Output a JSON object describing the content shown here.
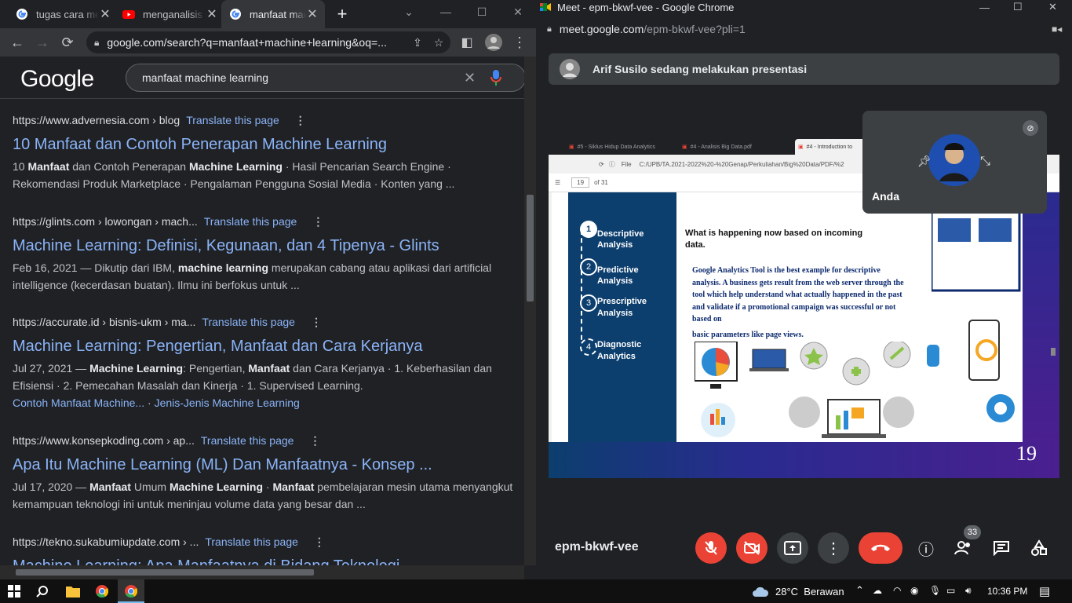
{
  "left_browser": {
    "tabs": [
      {
        "title": "tugas cara membuat",
        "favicon": "google-g-icon"
      },
      {
        "title": "menganalisis data",
        "favicon": "youtube-icon"
      },
      {
        "title": "manfaat machine learning",
        "favicon": "google-g-icon"
      }
    ],
    "new_tab": "+",
    "url": "google.com/search?q=manfaat+machine+learning&oq=...",
    "logo": "Google",
    "search_query": "manfaat machine learning",
    "results": [
      {
        "url": "https://www.advernesia.com › blog",
        "translate": "Translate this page",
        "title": "10 Manfaat dan Contoh Penerapan Machine Learning",
        "snippet_html": "10 <b>Manfaat</b> dan Contoh Penerapan <b>Machine Learning</b> · Hasil Pencarian Search Engine · Rekomendasi Produk Marketplace · Pengalaman Pengguna Sosial Media · Konten yang ..."
      },
      {
        "url": "https://glints.com › lowongan › mach...",
        "translate": "Translate this page",
        "title": "Machine Learning: Definisi, Kegunaan, dan 4 Tipenya - Glints",
        "snippet_html": "Feb 16, 2021 — Dikutip dari IBM, <b>machine learning</b> merupakan cabang atau aplikasi dari artificial intelligence (kecerdasan buatan). Ilmu ini berfokus untuk ..."
      },
      {
        "url": "https://accurate.id › bisnis-ukm › ma...",
        "translate": "Translate this page",
        "title": "Machine Learning: Pengertian, Manfaat dan Cara Kerjanya",
        "snippet_html": "Jul 27, 2021 — <b>Machine Learning</b>: Pengertian, <b>Manfaat</b> dan Cara Kerjanya · 1. Keberhasilan dan Efisiensi · 2. Pemecahan Masalah dan Kinerja · 1. Supervised Learning.",
        "sublinks": [
          "Contoh Manfaat Machine...",
          "·",
          "Jenis-Jenis Machine Learning"
        ]
      },
      {
        "url": "https://www.konsepkoding.com › ap...",
        "translate": "Translate this page",
        "title": "Apa Itu Machine Learning (ML) Dan Manfaatnya - Konsep ...",
        "snippet_html": "Jul 17, 2020 — <b>Manfaat</b> Umum <b>Machine Learning</b> · <b>Manfaat</b> pembelajaran mesin utama menyangkut kemampuan teknologi ini untuk meninjau volume data yang besar dan ..."
      },
      {
        "url": "https://tekno.sukabumiupdate.com › ...",
        "translate": "Translate this page",
        "title": "Machine Learning: Apa Manfaatnya di Bidang Teknologi"
      }
    ]
  },
  "right_window": {
    "window_title": "Meet - epm-bkwf-vee - Google Chrome",
    "url_host": "meet.google.com",
    "url_path": "/epm-bkwf-vee?pli=1",
    "presenting_banner": "Arif Susilo sedang melakukan presentasi",
    "self_name": "Anda",
    "meeting_code": "epm-bkwf-vee",
    "participant_count": "33",
    "slide": {
      "pdf_tabs": [
        "#5 - Siklus Hidup Data Analytics",
        "#4 - Analisis Big Data.pdf",
        "#4 - Introduction to"
      ],
      "file_label": "File",
      "file_path": "C:/UPB/TA.2021-2022%20-%20Genap/Perkuliahan/Big%20Data/PDF/%2",
      "page_current": "19",
      "page_total": "of 31",
      "steps": [
        {
          "num": "1",
          "label": "Descriptive Analysis"
        },
        {
          "num": "2",
          "label": "Predictive Analysis"
        },
        {
          "num": "3",
          "label": "Prescriptive Analysis"
        },
        {
          "num": "4",
          "label": "Diagnostic Analytics"
        }
      ],
      "heading": "What is happening now based on incoming data.",
      "body": "Google Analytics Tool is the best example for descriptive analysis. A business gets result from the web server through the tool which help understand what actually happened in the past and validate if a promotional campaign was successful or not based on",
      "body2": "basic parameters like page views.",
      "page_number": "19"
    }
  },
  "taskbar": {
    "weather": "28°C  Berawan",
    "time": "10:36 PM"
  },
  "colors": {
    "link_blue": "#8ab4f8",
    "end_call_red": "#ea4335",
    "slide_navy": "#0c3e6e",
    "slide_purple": "#4a1f8f"
  }
}
